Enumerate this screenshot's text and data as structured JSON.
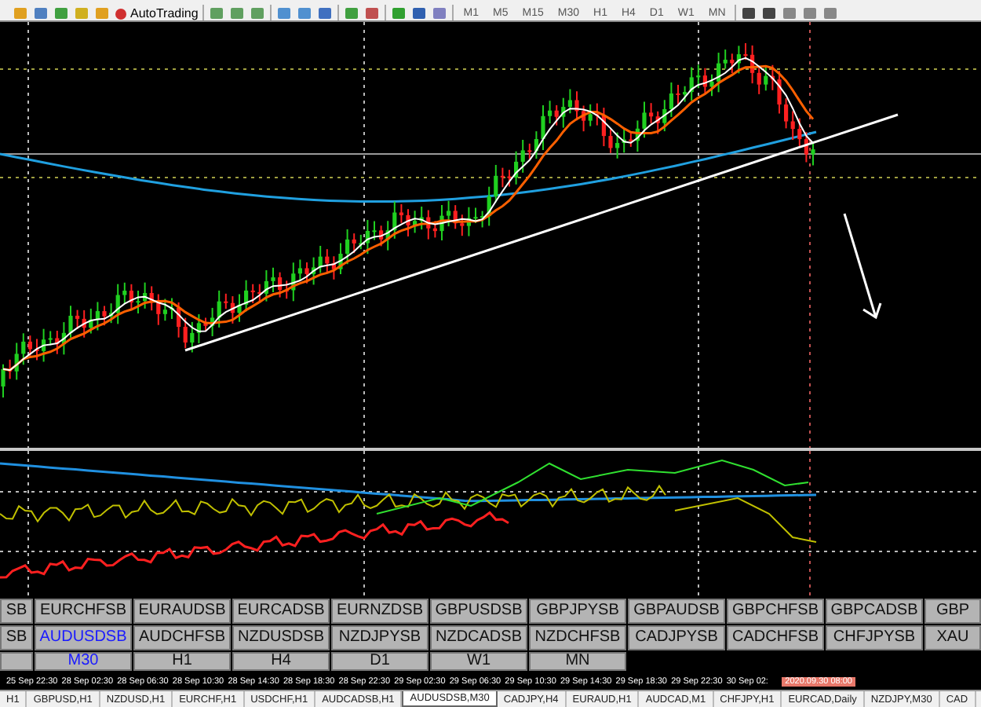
{
  "toolbar": {
    "autotrading": "AutoTrading",
    "timeframes": [
      "M1",
      "M5",
      "M15",
      "M30",
      "H1",
      "H4",
      "D1",
      "W1",
      "MN"
    ]
  },
  "symbol_rows": [
    [
      {
        "label": "SB",
        "selected": false
      },
      {
        "label": "EURCHFSB",
        "selected": false
      },
      {
        "label": "EURAUDSB",
        "selected": false
      },
      {
        "label": "EURCADSB",
        "selected": false
      },
      {
        "label": "EURNZDSB",
        "selected": false
      },
      {
        "label": "GBPUSDSB",
        "selected": false
      },
      {
        "label": "GBPJPYSB",
        "selected": false
      },
      {
        "label": "GBPAUDSB",
        "selected": false
      },
      {
        "label": "GBPCHFSB",
        "selected": false
      },
      {
        "label": "GBPCADSB",
        "selected": false
      },
      {
        "label": "GBP",
        "selected": false
      }
    ],
    [
      {
        "label": "SB",
        "selected": false
      },
      {
        "label": "AUDUSDSB",
        "selected": true
      },
      {
        "label": "AUDCHFSB",
        "selected": false
      },
      {
        "label": "NZDUSDSB",
        "selected": false
      },
      {
        "label": "NZDJPYSB",
        "selected": false
      },
      {
        "label": "NZDCADSB",
        "selected": false
      },
      {
        "label": "NZDCHFSB",
        "selected": false
      },
      {
        "label": "CADJPYSB",
        "selected": false
      },
      {
        "label": "CADCHFSB",
        "selected": false
      },
      {
        "label": "CHFJPYSB",
        "selected": false
      },
      {
        "label": "XAU",
        "selected": false
      }
    ]
  ],
  "timeframe_buttons": [
    {
      "label": "M30",
      "selected": true
    },
    {
      "label": "H1",
      "selected": false
    },
    {
      "label": "H4",
      "selected": false
    },
    {
      "label": "D1",
      "selected": false
    },
    {
      "label": "W1",
      "selected": false
    },
    {
      "label": "MN",
      "selected": false
    }
  ],
  "time_axis": {
    "labels": [
      "25 Sep 22:30",
      "28 Sep 02:30",
      "28 Sep 06:30",
      "28 Sep 10:30",
      "28 Sep 14:30",
      "28 Sep 18:30",
      "28 Sep 22:30",
      "29 Sep 02:30",
      "29 Sep 06:30",
      "29 Sep 10:30",
      "29 Sep 14:30",
      "29 Sep 18:30",
      "29 Sep 22:30",
      "30 Sep 02:"
    ],
    "cursor_time": "2020.09.30 08:00"
  },
  "tabs": [
    {
      "label": "H1",
      "selected": false
    },
    {
      "label": "GBPUSD,H1",
      "selected": false
    },
    {
      "label": "NZDUSD,H1",
      "selected": false
    },
    {
      "label": "EURCHF,H1",
      "selected": false
    },
    {
      "label": "USDCHF,H1",
      "selected": false
    },
    {
      "label": "AUDCADSB,H1",
      "selected": false
    },
    {
      "label": "AUDUSDSB,M30",
      "selected": true
    },
    {
      "label": "CADJPY,H4",
      "selected": false
    },
    {
      "label": "EURAUD,H1",
      "selected": false
    },
    {
      "label": "AUDCAD,M1",
      "selected": false
    },
    {
      "label": "CHFJPY,H1",
      "selected": false
    },
    {
      "label": "EURCAD,Daily",
      "selected": false
    },
    {
      "label": "NZDJPY,M30",
      "selected": false
    },
    {
      "label": "CAD",
      "selected": false
    }
  ]
}
